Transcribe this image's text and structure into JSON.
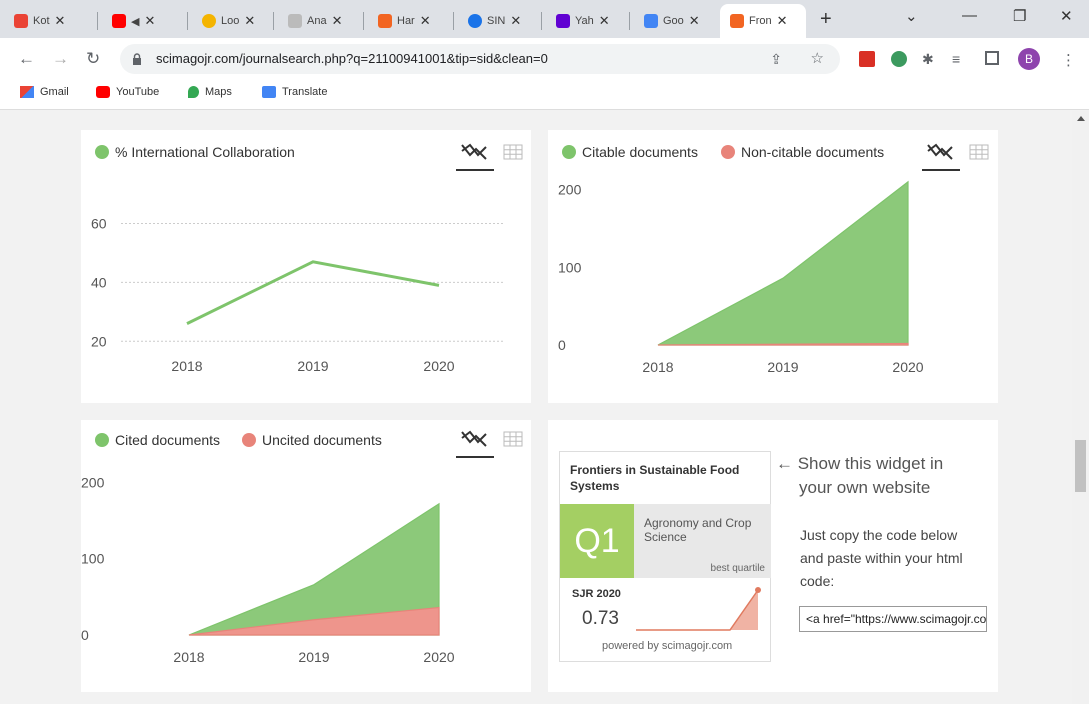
{
  "browser": {
    "tabs": [
      {
        "label": "Kot",
        "color": "#ea4335"
      },
      {
        "label": "",
        "color": "#ff0000"
      },
      {
        "label": "Loo",
        "color": "#f4b400"
      },
      {
        "label": "Ana",
        "color": "#8a8a8a"
      },
      {
        "label": "Har",
        "color": "#f26522"
      },
      {
        "label": "SIN",
        "color": "#1a73e8"
      },
      {
        "label": "Yah",
        "color": "#6001d2"
      },
      {
        "label": "Goo",
        "color": "#4285f4"
      },
      {
        "label": "Fron",
        "color": "#f26522"
      }
    ],
    "url": "scimagojr.com/journalsearch.php?q=21100941001&tip=sid&clean=0",
    "profile_initial": "B",
    "bookmarks": [
      "Gmail",
      "YouTube",
      "Maps",
      "Translate"
    ]
  },
  "colors": {
    "green": "#7ec46b",
    "green_fill": "#8cc97a",
    "red": "#e8847a",
    "red_fill": "#ee958c"
  },
  "chart_data": [
    {
      "type": "line",
      "legend": [
        "% International Collaboration"
      ],
      "categories": [
        "2018",
        "2019",
        "2020"
      ],
      "series": [
        {
          "name": "% International Collaboration",
          "values": [
            26,
            47,
            39
          ]
        }
      ],
      "ylim": [
        15,
        68
      ],
      "yticks": [
        "20",
        "40",
        "60"
      ],
      "grid": true,
      "legend_position": "top-left"
    },
    {
      "type": "area",
      "legend": [
        "Citable documents",
        "Non-citable documents"
      ],
      "categories": [
        "2018",
        "2019",
        "2020"
      ],
      "series": [
        {
          "name": "Citable documents",
          "values": [
            0,
            86,
            210
          ]
        },
        {
          "name": "Non-citable documents",
          "values": [
            0,
            1,
            2
          ]
        }
      ],
      "ylim": [
        0,
        215
      ],
      "yticks": [
        "0",
        "100",
        "200"
      ],
      "grid": false,
      "legend_position": "top-left"
    },
    {
      "type": "area",
      "legend": [
        "Cited documents",
        "Uncited documents"
      ],
      "categories": [
        "2018",
        "2019",
        "2020"
      ],
      "series": [
        {
          "name": "Cited documents",
          "values": [
            0,
            66,
            172
          ]
        },
        {
          "name": "Uncited documents",
          "values": [
            0,
            20,
            36
          ]
        }
      ],
      "ylim": [
        0,
        215
      ],
      "yticks": [
        "0",
        "100",
        "200"
      ],
      "grid": false,
      "legend_position": "top-left"
    }
  ],
  "widget": {
    "journal": "Frontiers in Sustainable Food Systems",
    "quartile": "Q1",
    "category": "Agronomy and Crop Science",
    "best_quartile": "best quartile",
    "sjr_label": "SJR 2020",
    "sjr_value": "0.73",
    "powered_by": "powered by scimagojr.com",
    "show_line1": "← Show this widget in",
    "show_line2": "your own website",
    "copy_line1": "Just copy the code below",
    "copy_line2": "and paste within your html",
    "copy_line3": "code:",
    "code": "<a href=\"https://www.scimagojr.com"
  }
}
